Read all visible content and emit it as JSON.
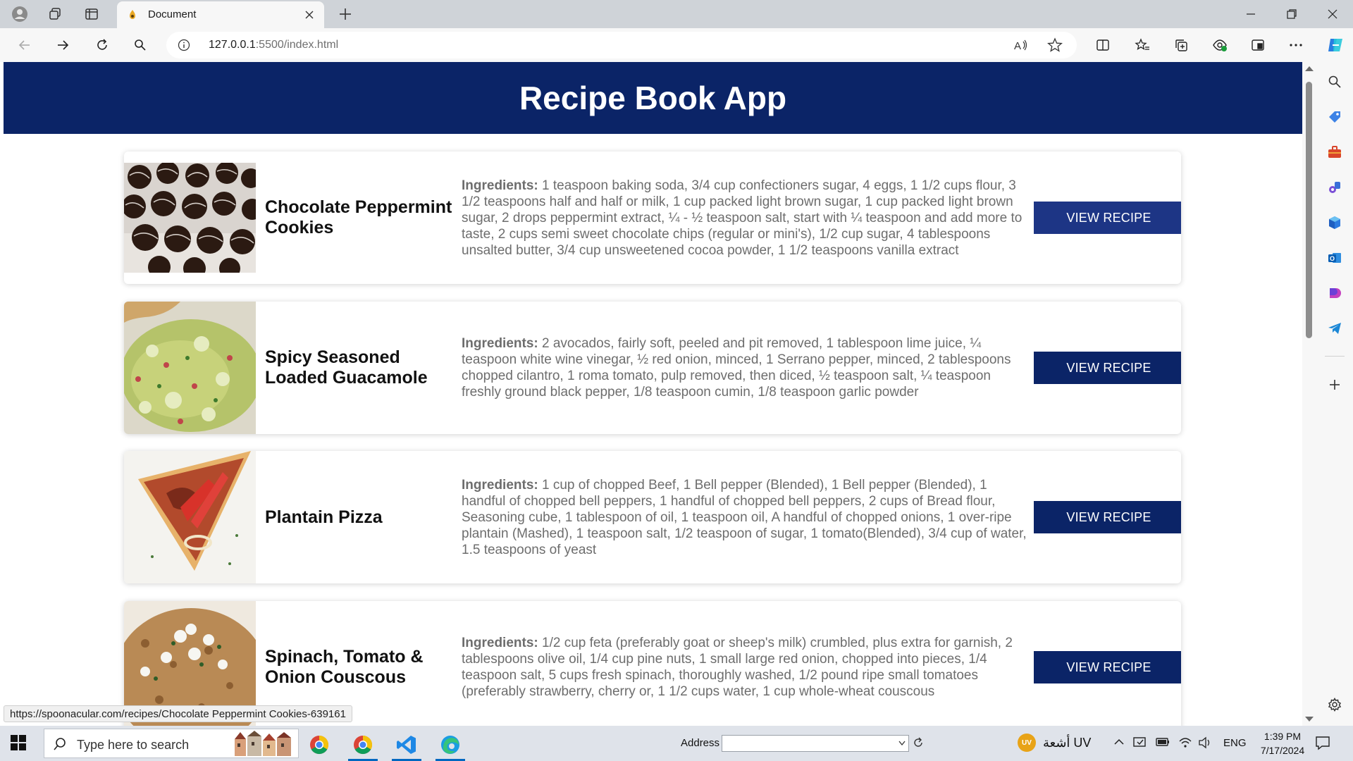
{
  "browser": {
    "tab_title": "Document",
    "url_host": "127.0.0.1",
    "url_path": ":5500/index.html"
  },
  "page": {
    "heading": "Recipe Book App",
    "ingredients_label": "Ingredients:",
    "button_label": "VIEW RECIPE"
  },
  "recipes": [
    {
      "title": "Chocolate Peppermint Cookies",
      "ingredients": "1 teaspoon baking soda, 3/4 cup confectioners sugar, 4 eggs, 1 1/2 cups flour, 3 1/2 teaspoons half and half or milk, 1 cup packed light brown sugar, 1 cup packed light brown sugar, 2 drops peppermint extract, ¼ - ½ teaspoon salt, start with ¼ teaspoon and add more to taste, 2 cups semi sweet chocolate chips (regular or mini's), 1/2 cup sugar, 4 tablespoons unsalted butter, 3/4 cup unsweetened cocoa powder, 1 1/2 teaspoons vanilla extract"
    },
    {
      "title": "Spicy Seasoned Loaded Guacamole",
      "ingredients": "2 avocados, fairly soft, peeled and pit removed, 1 tablespoon lime juice, ¼ teaspoon white wine vinegar, ½ red onion, minced, 1 Serrano pepper, minced, 2 tablespoons chopped cilantro, 1 roma tomato, pulp removed, then diced, ½ teaspoon salt, ¼ teaspoon freshly ground black pepper, 1/8 teaspoon cumin, 1/8 teaspoon garlic powder"
    },
    {
      "title": "Plantain Pizza",
      "ingredients": "1 cup of chopped Beef, 1 Bell pepper (Blended), 1 Bell pepper (Blended), 1 handful of chopped bell peppers, 1 handful of chopped bell peppers, 2 cups of Bread flour, Seasoning cube, 1 tablespoon of oil, 1 teaspoon oil, A handful of chopped onions, 1 over-ripe plantain (Mashed), 1 teaspoon salt, 1/2 teaspoon of sugar, 1 tomato(Blended), 3/4 cup of water, 1.5 teaspoons of yeast"
    },
    {
      "title": "Spinach, Tomato & Onion Couscous",
      "ingredients": "1/2 cup feta (preferably goat or sheep's milk) crumbled, plus extra for garnish, 2 tablespoons olive oil, 1/4 cup pine nuts, 1 small large red onion, chopped into pieces, 1/4 teaspoon salt, 5 cups fresh spinach, thoroughly washed, 1/2 pound ripe small tomatoes (preferably strawberry, cherry or, 1 1/2 cups water, 1 cup whole-wheat couscous"
    }
  ],
  "status_url": "https://spoonacular.com/recipes/Chocolate Peppermint Cookies-639161",
  "taskbar": {
    "search_placeholder": "Type here to search",
    "address_label": "Address",
    "weather_badge": "UV",
    "weather_text": "أشعة UV",
    "language": "ENG",
    "time": "1:39 PM",
    "date": "7/17/2024"
  },
  "colors": {
    "header_bg": "#0b2467",
    "button_bg": "#1d3585",
    "button_bg_focus": "#0b2467"
  }
}
